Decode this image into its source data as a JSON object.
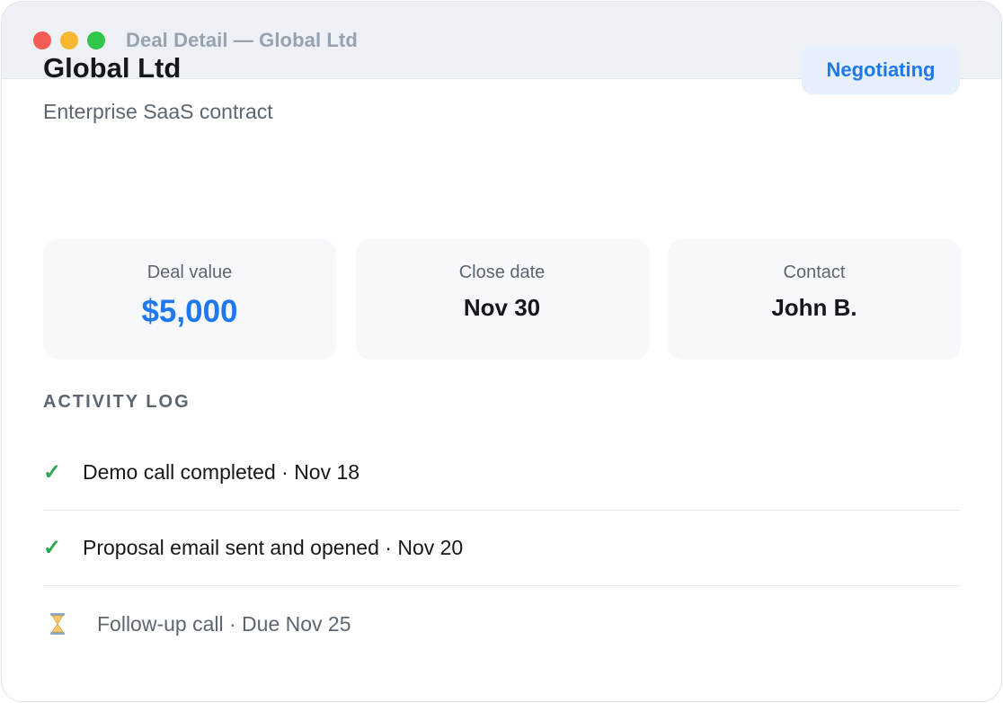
{
  "window": {
    "title": "Deal Detail — Global Ltd",
    "controls": [
      "close",
      "minimize",
      "maximize"
    ],
    "colors": {
      "close": "#f45b52",
      "minimize": "#f7b731",
      "maximize": "#2fc64a"
    }
  },
  "deal": {
    "name": "Global Ltd",
    "description": "Enterprise SaaS contract",
    "status": "Negotiating",
    "status_color": "#1e78f0"
  },
  "stats": [
    {
      "label": "Deal value",
      "value": "$5,000"
    },
    {
      "label": "Close date",
      "value": "Nov 30"
    },
    {
      "label": "Contact",
      "value": "John B."
    }
  ],
  "activity": {
    "title": "ACTIVITY LOG",
    "items": [
      {
        "icon": "check-icon",
        "text": "Demo call completed · Nov 18",
        "done": true
      },
      {
        "icon": "check-icon",
        "text": "Proposal email sent and opened · Nov 20",
        "done": true
      },
      {
        "icon": "hourglass-icon",
        "text": "Follow-up call · Due Nov 25",
        "done": false
      }
    ]
  }
}
